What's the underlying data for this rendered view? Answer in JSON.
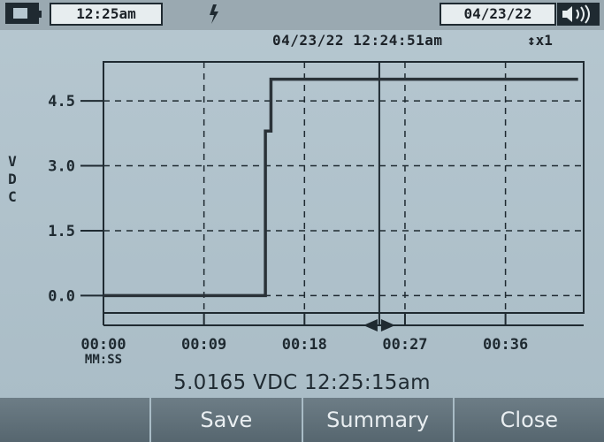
{
  "status_bar": {
    "time": "12:25am",
    "date": "04/23/22"
  },
  "header": {
    "timestamp": "04/23/22  12:24:51am",
    "zoom": "↕x1"
  },
  "chart_data": {
    "type": "line",
    "ylabel": "V D C",
    "xlabel": "MM:SS",
    "x_ticks": [
      "00:00",
      "00:09",
      "00:18",
      "00:27",
      "00:36"
    ],
    "y_ticks": [
      "0.0",
      "1.5",
      "3.0",
      "4.5"
    ],
    "xlim": [
      0,
      43
    ],
    "ylim": [
      -0.4,
      5.4
    ],
    "grid": true,
    "cursor_x": 24.7,
    "series": [
      {
        "values_x": [
          0,
          14.5,
          14.5,
          15.0,
          15.0,
          42.5
        ],
        "values_y": [
          0.0,
          0.0,
          3.8,
          3.8,
          5.0,
          5.0
        ]
      }
    ]
  },
  "readout": "5.0165 VDC 12:25:15am",
  "softkeys": [
    "",
    "Save",
    "Summary",
    "Close"
  ],
  "colors": {
    "background": "#b6c7d0",
    "ink": "#1f2a31",
    "softkey": "#5f6f78"
  }
}
